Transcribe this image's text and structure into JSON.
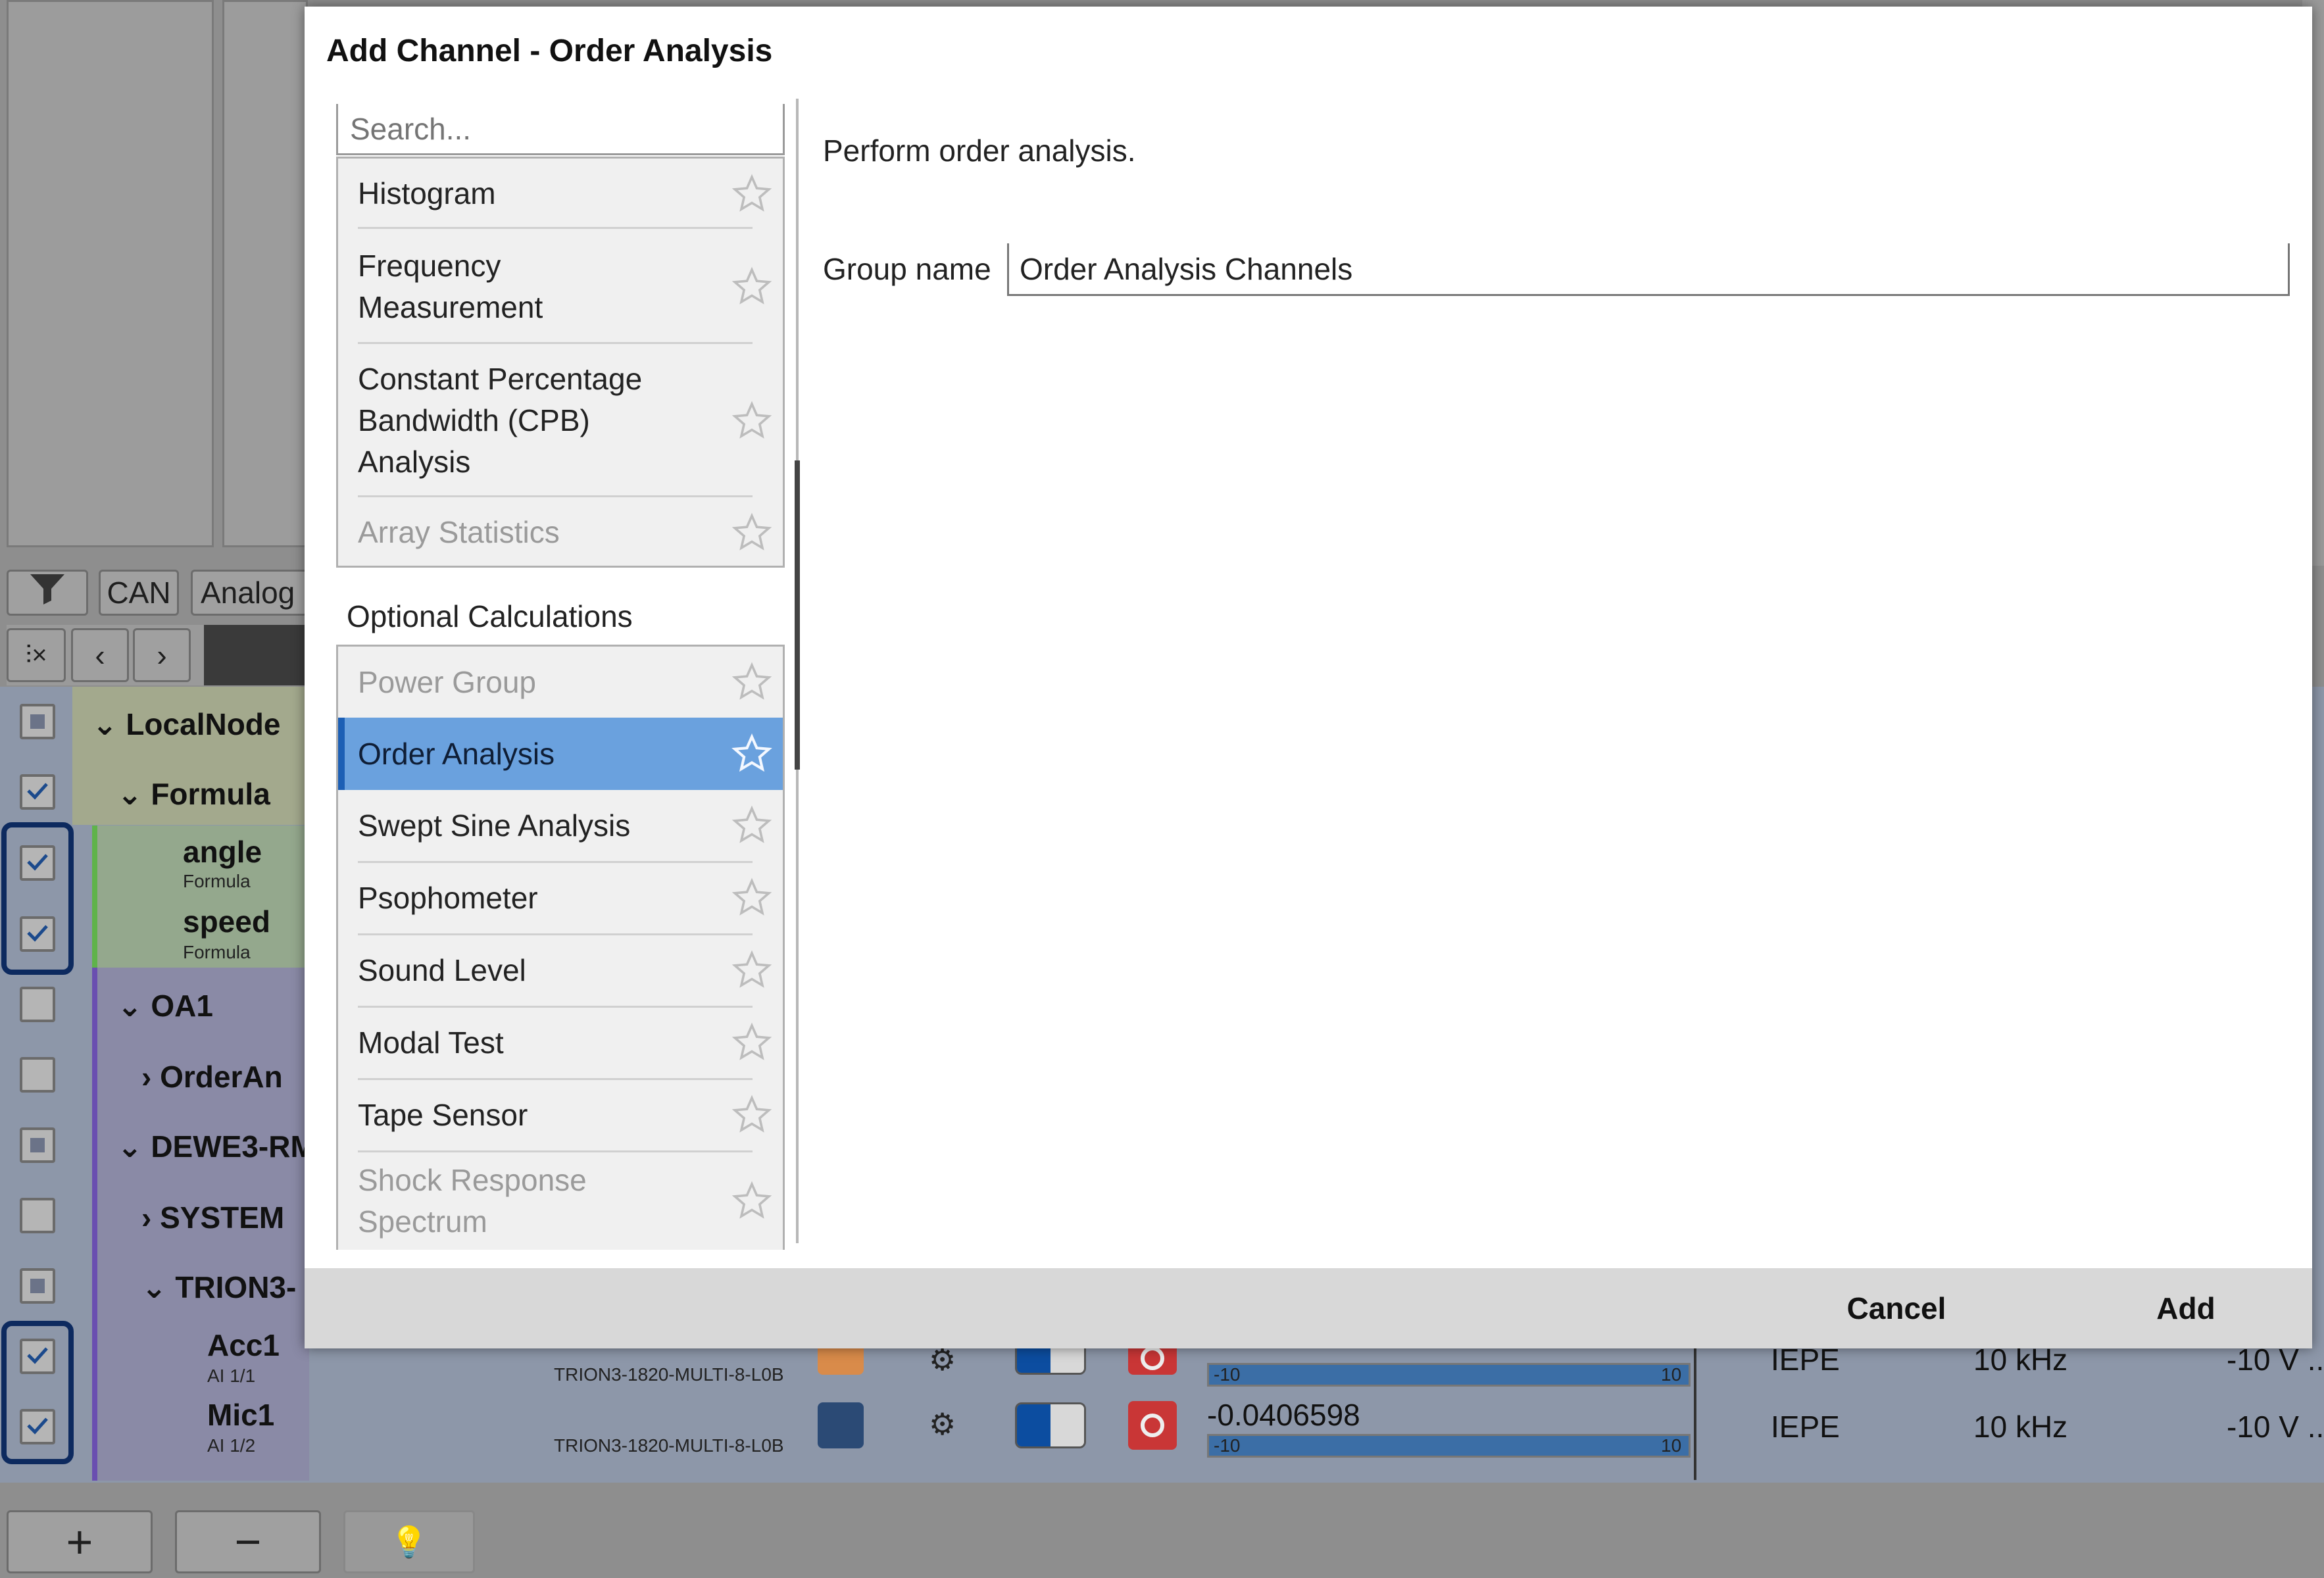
{
  "dialog": {
    "title": "Add Channel - Order Analysis",
    "search_placeholder": "Search...",
    "list_top": [
      {
        "label": "Histogram",
        "disabled": false
      },
      {
        "label": "Frequency\nMeasurement",
        "disabled": false
      },
      {
        "label": "Constant Percentage\nBandwidth (CPB)\nAnalysis",
        "disabled": false
      },
      {
        "label": "Array Statistics",
        "disabled": true
      }
    ],
    "section_label": "Optional Calculations",
    "list_optional": [
      {
        "label": "Power Group",
        "disabled": true,
        "selected": false
      },
      {
        "label": "Order Analysis",
        "disabled": false,
        "selected": true
      },
      {
        "label": "Swept Sine Analysis",
        "disabled": false,
        "selected": false
      },
      {
        "label": "Psophometer",
        "disabled": false,
        "selected": false
      },
      {
        "label": "Sound Level",
        "disabled": false,
        "selected": false
      },
      {
        "label": "Modal Test",
        "disabled": false,
        "selected": false
      },
      {
        "label": "Tape Sensor",
        "disabled": false,
        "selected": false
      },
      {
        "label": "Shock Response\nSpectrum",
        "disabled": true,
        "selected": false
      }
    ],
    "description": "Perform order analysis.",
    "group_name_label": "Group name",
    "group_name_value": "Order Analysis Channels",
    "cancel_label": "Cancel",
    "add_label": "Add"
  },
  "background": {
    "filter_tabs": [
      "CAN",
      "Analog"
    ],
    "tree": {
      "localnode": "LocalNode",
      "formula": "Formula",
      "angle": "angle",
      "angle_sub": "Formula",
      "speed": "speed",
      "speed_sub": "Formula",
      "oa1": "OA1",
      "orderan": "OrderAn",
      "dewe3": "DEWE3-RM",
      "system": "SYSTEM",
      "trion": "TRION3-",
      "acc1": "Acc1",
      "acc1_sub": "AI 1/1",
      "mic1": "Mic1",
      "mic1_sub": "AI 1/2"
    },
    "mic1_row": {
      "device": "TRION3-1820-MULTI-8-L0B",
      "value": "-0.0406598",
      "bar_min": "-10",
      "bar_max": "10",
      "mode": "IEPE",
      "rate": "10 kHz",
      "range": "-10 V .."
    },
    "acc1_row": {
      "device": "TRION3-1820-MULTI-8-L0B",
      "bar_min": "-10",
      "bar_max": "10",
      "mode": "IEPE",
      "rate": "10 kHz",
      "range": "-10 V .."
    },
    "colors": {
      "mic1": "#2b4a75",
      "acc1": "#d98b4a",
      "accent": "#0c4da0"
    }
  }
}
